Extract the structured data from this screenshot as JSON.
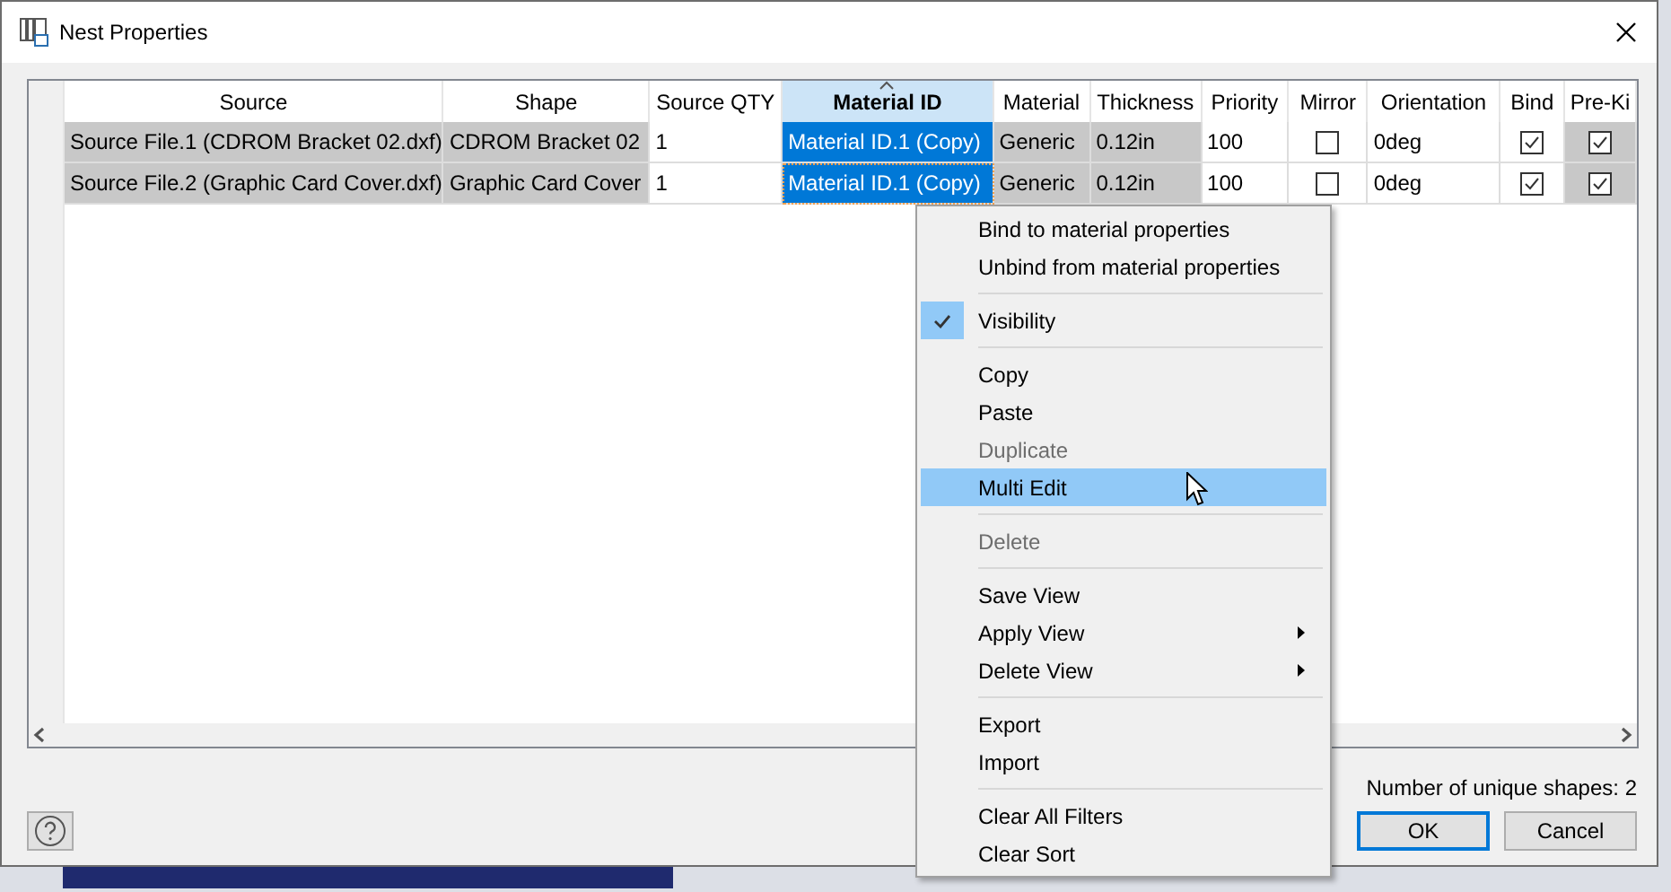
{
  "window": {
    "title": "Nest Properties"
  },
  "table": {
    "columns": [
      {
        "label": "Source",
        "selected": false
      },
      {
        "label": "Shape",
        "selected": false
      },
      {
        "label": "Source QTY",
        "selected": false
      },
      {
        "label": "Material ID",
        "selected": true,
        "sorted": true
      },
      {
        "label": "Material",
        "selected": false
      },
      {
        "label": "Thickness",
        "selected": false
      },
      {
        "label": "Priority",
        "selected": false
      },
      {
        "label": "Mirror",
        "selected": false
      },
      {
        "label": "Orientation",
        "selected": false
      },
      {
        "label": "Bind",
        "selected": false
      },
      {
        "label": "Pre-Ki",
        "selected": false
      }
    ],
    "rows": [
      {
        "cells": [
          {
            "kind": "text",
            "text": "Source File.1 (CDROM Bracket 02.dxf)",
            "readonly": true,
            "selected": false,
            "focused": false
          },
          {
            "kind": "text",
            "text": "CDROM Bracket 02",
            "readonly": true,
            "selected": false,
            "focused": false
          },
          {
            "kind": "text",
            "text": "1",
            "readonly": false,
            "selected": false,
            "focused": false
          },
          {
            "kind": "text",
            "text": "Material ID.1 (Copy)",
            "readonly": false,
            "selected": true,
            "focused": false
          },
          {
            "kind": "text",
            "text": "Generic",
            "readonly": true,
            "selected": false,
            "focused": false
          },
          {
            "kind": "text",
            "text": "0.12in",
            "readonly": true,
            "selected": false,
            "focused": false
          },
          {
            "kind": "text",
            "text": "100",
            "readonly": false,
            "selected": false,
            "focused": false
          },
          {
            "kind": "check",
            "checked": false,
            "readonly": false
          },
          {
            "kind": "text",
            "text": "0deg",
            "readonly": false,
            "selected": false,
            "focused": false
          },
          {
            "kind": "check",
            "checked": true,
            "readonly": false
          },
          {
            "kind": "check",
            "checked": true,
            "readonly": true
          }
        ]
      },
      {
        "cells": [
          {
            "kind": "text",
            "text": "Source File.2 (Graphic Card Cover.dxf)",
            "readonly": true,
            "selected": false,
            "focused": false
          },
          {
            "kind": "text",
            "text": "Graphic Card Cover",
            "readonly": true,
            "selected": false,
            "focused": false
          },
          {
            "kind": "text",
            "text": "1",
            "readonly": false,
            "selected": false,
            "focused": false
          },
          {
            "kind": "text",
            "text": "Material ID.1 (Copy)",
            "readonly": false,
            "selected": true,
            "focused": true
          },
          {
            "kind": "text",
            "text": "Generic",
            "readonly": true,
            "selected": false,
            "focused": false
          },
          {
            "kind": "text",
            "text": "0.12in",
            "readonly": true,
            "selected": false,
            "focused": false
          },
          {
            "kind": "text",
            "text": "100",
            "readonly": false,
            "selected": false,
            "focused": false
          },
          {
            "kind": "check",
            "checked": false,
            "readonly": false
          },
          {
            "kind": "text",
            "text": "0deg",
            "readonly": false,
            "selected": false,
            "focused": false
          },
          {
            "kind": "check",
            "checked": true,
            "readonly": false
          },
          {
            "kind": "check",
            "checked": true,
            "readonly": true
          }
        ]
      }
    ]
  },
  "status": "Number of unique shapes: 2",
  "buttons": [
    {
      "label": "OK",
      "default": true
    },
    {
      "label": "Cancel",
      "default": false
    }
  ],
  "context_menu": {
    "items": [
      {
        "kind": "item",
        "label": "Bind to material properties",
        "disabled": false,
        "checked": false,
        "selected": false,
        "submenu": false
      },
      {
        "kind": "item",
        "label": "Unbind from material properties",
        "disabled": false,
        "checked": false,
        "selected": false,
        "submenu": false
      },
      {
        "kind": "separator"
      },
      {
        "kind": "item",
        "label": "Visibility",
        "disabled": false,
        "checked": true,
        "selected": false,
        "submenu": false
      },
      {
        "kind": "separator"
      },
      {
        "kind": "item",
        "label": "Copy",
        "disabled": false,
        "checked": false,
        "selected": false,
        "submenu": false
      },
      {
        "kind": "item",
        "label": "Paste",
        "disabled": false,
        "checked": false,
        "selected": false,
        "submenu": false
      },
      {
        "kind": "item",
        "label": "Duplicate",
        "disabled": true,
        "checked": false,
        "selected": false,
        "submenu": false
      },
      {
        "kind": "item",
        "label": "Multi Edit",
        "disabled": false,
        "checked": false,
        "selected": true,
        "submenu": false
      },
      {
        "kind": "separator"
      },
      {
        "kind": "item",
        "label": "Delete",
        "disabled": true,
        "checked": false,
        "selected": false,
        "submenu": false
      },
      {
        "kind": "separator"
      },
      {
        "kind": "item",
        "label": "Save View",
        "disabled": false,
        "checked": false,
        "selected": false,
        "submenu": false
      },
      {
        "kind": "item",
        "label": "Apply View",
        "disabled": false,
        "checked": false,
        "selected": false,
        "submenu": true
      },
      {
        "kind": "item",
        "label": "Delete View",
        "disabled": false,
        "checked": false,
        "selected": false,
        "submenu": true
      },
      {
        "kind": "separator"
      },
      {
        "kind": "item",
        "label": "Export",
        "disabled": false,
        "checked": false,
        "selected": false,
        "submenu": false
      },
      {
        "kind": "item",
        "label": "Import",
        "disabled": false,
        "checked": false,
        "selected": false,
        "submenu": false
      },
      {
        "kind": "separator"
      },
      {
        "kind": "item",
        "label": "Clear All Filters",
        "disabled": false,
        "checked": false,
        "selected": false,
        "submenu": false
      },
      {
        "kind": "item",
        "label": "Clear Sort",
        "disabled": false,
        "checked": false,
        "selected": false,
        "submenu": false
      }
    ]
  }
}
